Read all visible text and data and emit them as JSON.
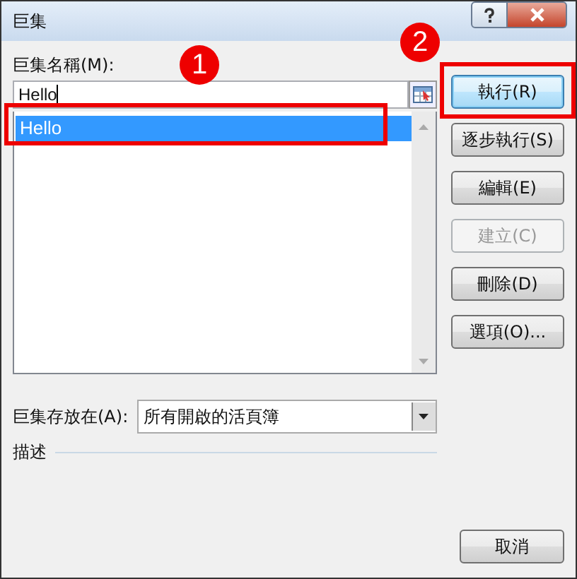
{
  "window": {
    "title": "巨集"
  },
  "macro_name": {
    "label": "巨集名稱(M):",
    "value": "Hello"
  },
  "macros": [
    {
      "name": "Hello",
      "selected": true
    }
  ],
  "buttons": [
    {
      "label": "執行(R)",
      "disabled": false,
      "focused": true
    },
    {
      "label": "逐步執行(S)",
      "disabled": false,
      "focused": false
    },
    {
      "label": "編輯(E)",
      "disabled": false,
      "focused": false
    },
    {
      "label": "建立(C)",
      "disabled": true,
      "focused": false
    },
    {
      "label": "刪除(D)",
      "disabled": false,
      "focused": false
    },
    {
      "label": "選項(O)...",
      "disabled": false,
      "focused": false
    }
  ],
  "macros_in": {
    "label": "巨集存放在(A):",
    "value": "所有開啟的活頁簿"
  },
  "description": {
    "label": "描述"
  },
  "cancel_button": "取消",
  "annotations": [
    {
      "label": "1"
    },
    {
      "label": "2"
    }
  ]
}
